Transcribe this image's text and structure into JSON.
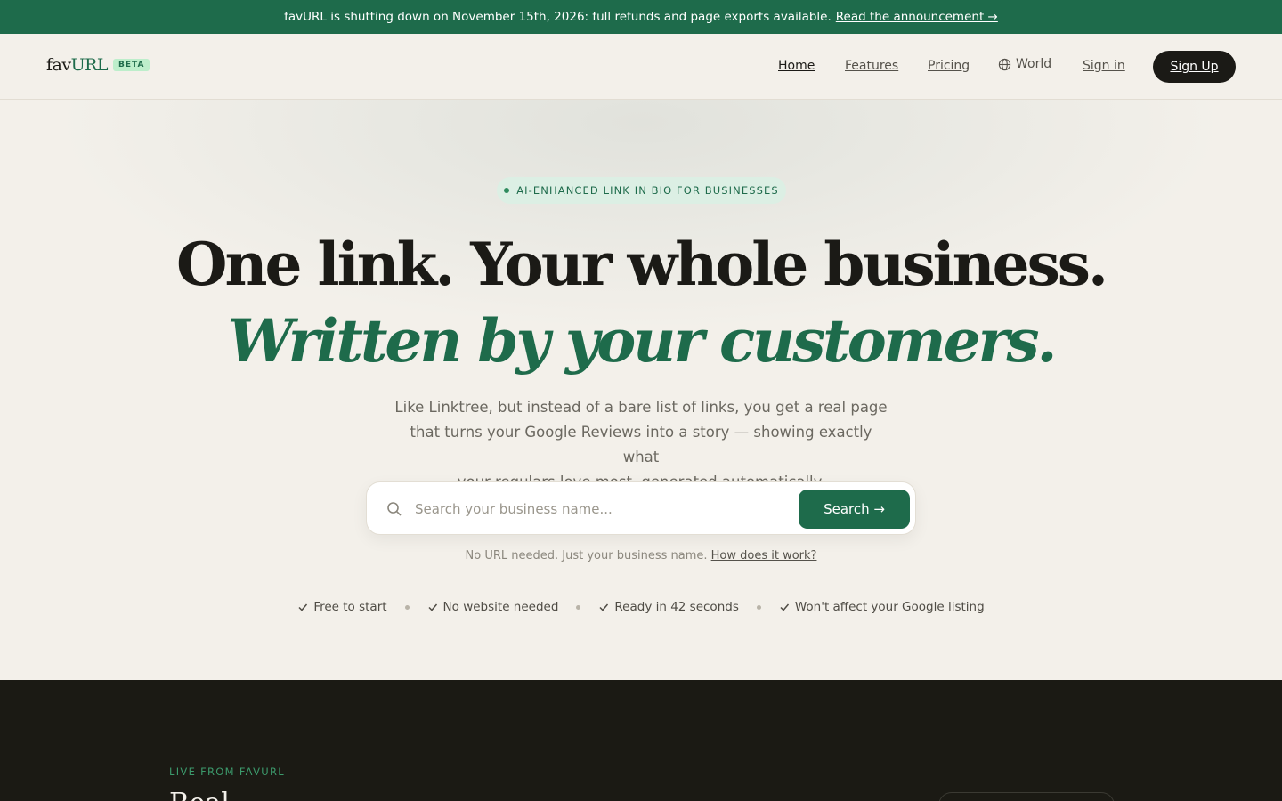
{
  "banner": {
    "text": "favURL is shutting down on November 15th, 2026: full refunds and page exports available.",
    "link": "Read the announcement →"
  },
  "header": {
    "logo_fav": "fav",
    "logo_url": "URL",
    "badge": "BETA",
    "nav": {
      "home": "Home",
      "features": "Features",
      "pricing": "Pricing",
      "world": "World",
      "sign_in": "Sign in",
      "sign_up": "Sign Up"
    }
  },
  "hero": {
    "pill": "AI-ENHANCED LINK IN BIO FOR BUSINESSES",
    "headline_1": "One link. Your whole business.",
    "headline_2": "Written by your customers.",
    "sub_line_1": "Like Linktree, but instead of a bare list of links, you get a real page",
    "sub_line_2": "that turns your Google Reviews into a story — showing exactly what",
    "sub_line_3": "your regulars love most, generated automatically.",
    "search": {
      "placeholder": "Search your business name...",
      "value": "",
      "button": "Search →"
    },
    "hint": "No URL needed. Just your business name.",
    "hint_link": "How does it work?",
    "features": [
      "Free to start",
      "No website needed",
      "Ready in 42 seconds",
      "Won't affect your Google listing"
    ]
  },
  "live_section": {
    "eyebrow": "LIVE FROM FAVURL",
    "title": "Real"
  },
  "colors": {
    "brand_green": "#1e6b4b",
    "ink": "#1b1a16",
    "cream": "#f3f0ea",
    "dark_section": "#1b1a14"
  },
  "icons": [
    "globe-icon",
    "search-icon",
    "check-icon"
  ]
}
